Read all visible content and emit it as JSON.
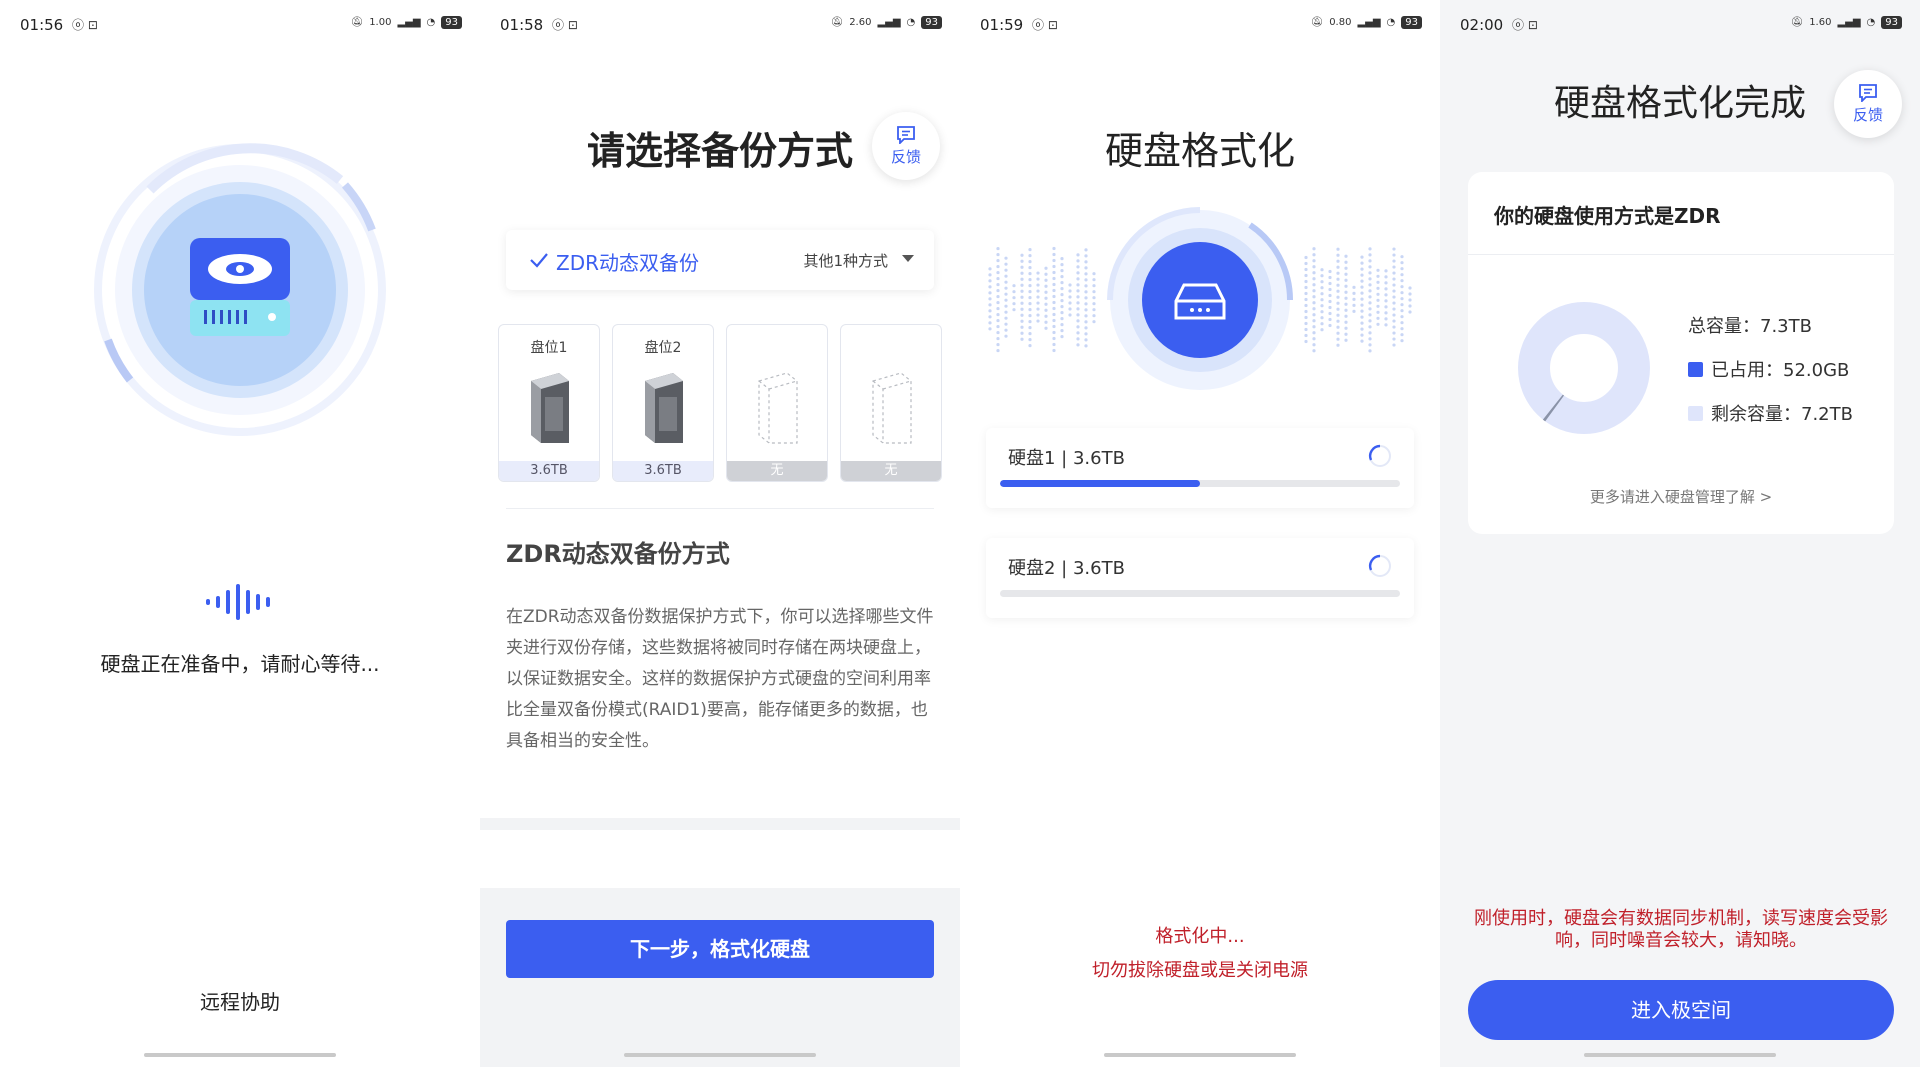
{
  "colors": {
    "accent": "#3b5ef0",
    "warning": "#c0202a",
    "light_accent": "#dfe5fb"
  },
  "screen1": {
    "status": {
      "time": "01:56",
      "battery": "93",
      "speed": "1.00"
    },
    "message": "硬盘正在准备中，请耐心等待...",
    "remote_label": "远程协助"
  },
  "screen2": {
    "status": {
      "time": "01:58",
      "battery": "93",
      "speed": "2.60"
    },
    "title": "请选择备份方式",
    "feedback_label": "反馈",
    "selected_mode": "ZDR动态双备份",
    "other_modes": "其他1种方式",
    "slots": [
      {
        "label": "盘位1",
        "capacity": "3.6TB",
        "filled": true
      },
      {
        "label": "盘位2",
        "capacity": "3.6TB",
        "filled": true
      },
      {
        "label": "",
        "capacity": "无",
        "filled": false
      },
      {
        "label": "",
        "capacity": "无",
        "filled": false
      }
    ],
    "mode_title": "ZDR动态双备份方式",
    "mode_description": "在ZDR动态双备份数据保护方式下，你可以选择哪些文件夹进行双份存储，这些数据将被同时存储在两块硬盘上，以保证数据安全。这样的数据保护方式硬盘的空间利用率比全量双备份模式(RAID1)要高，能存储更多的数据，也具备相当的安全性。",
    "next_button": "下一步，格式化硬盘"
  },
  "screen3": {
    "status": {
      "time": "01:59",
      "battery": "93",
      "speed": "0.80"
    },
    "title": "硬盘格式化",
    "disks": [
      {
        "label": "硬盘1 | 3.6TB",
        "progress": 0.5
      },
      {
        "label": "硬盘2 | 3.6TB",
        "progress": 0
      }
    ],
    "status_text": "格式化中...",
    "warning_text": "切勿拔除硬盘或是关闭电源"
  },
  "screen4": {
    "status": {
      "time": "02:00",
      "battery": "93",
      "speed": "1.60"
    },
    "title": "硬盘格式化完成",
    "feedback_label": "反馈",
    "card_title": "你的硬盘使用方式是ZDR",
    "total": "总容量：7.3TB",
    "used": "已占用：52.0GB",
    "free": "剩余容量：7.2TB",
    "usage_fraction": 0.007,
    "more_link": "更多请进入硬盘管理了解 >",
    "notice": "刚使用时，硬盘会有数据同步机制，读写速度会受影响，同时噪音会较大，请知晓。",
    "enter_button": "进入极空间"
  }
}
